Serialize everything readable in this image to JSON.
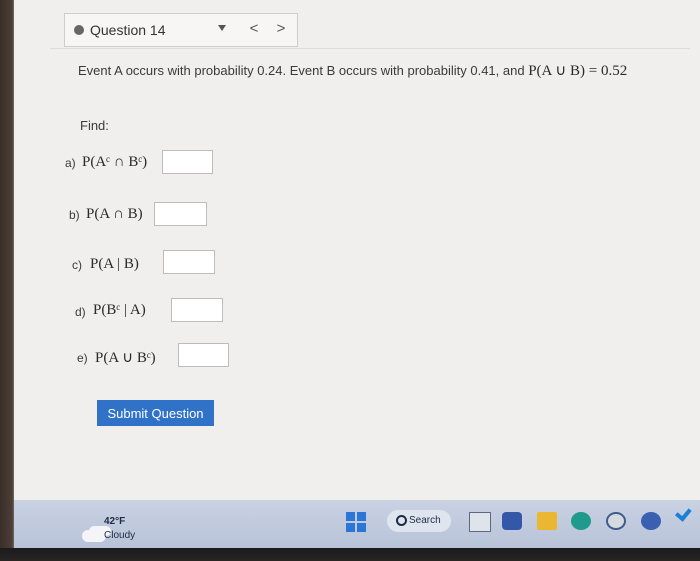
{
  "question": {
    "title": "Question 14",
    "prev_symbol": "<",
    "next_symbol": ">"
  },
  "problem": {
    "text": "Event A occurs with probability 0.24. Event B occurs with probability 0.41, and",
    "math": "P(A ∪ B) = 0.52"
  },
  "find_label": "Find:",
  "items": [
    {
      "label": "a)",
      "math": "P(Aᶜ ∩ Bᶜ)",
      "answer": ""
    },
    {
      "label": "b)",
      "math": "P(A ∩ B)",
      "answer": ""
    },
    {
      "label": "c)",
      "math": "P(A | B)",
      "answer": ""
    },
    {
      "label": "d)",
      "math": "P(Bᶜ | A)",
      "answer": ""
    },
    {
      "label": "e)",
      "math": "P(A ∪ Bᶜ)",
      "answer": ""
    }
  ],
  "submit_label": "Submit Question",
  "taskbar": {
    "weather_temp": "42°F",
    "weather_desc": "Cloudy",
    "search_label": "Search"
  },
  "colors": {
    "submit_button": "#2f72c8",
    "page_background": "#f1efed",
    "taskbar": "#c3cde0"
  }
}
